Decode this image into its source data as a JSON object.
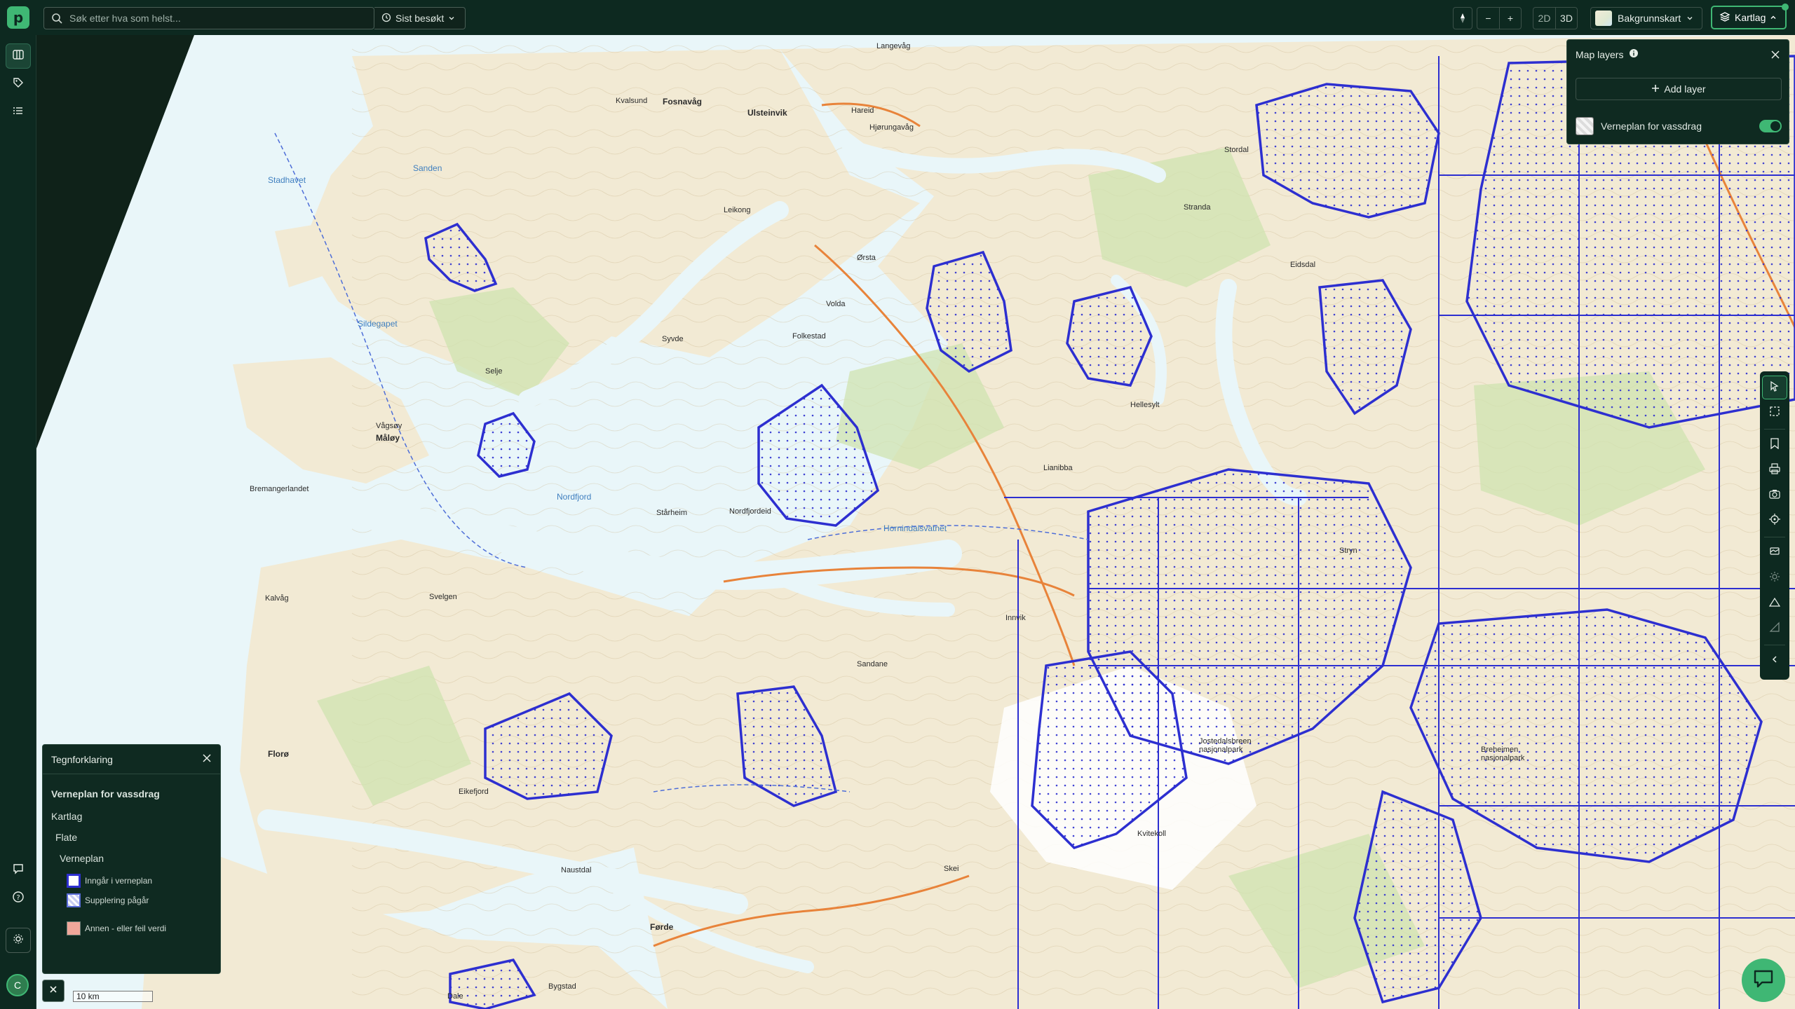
{
  "app": {
    "logo_letter": "p"
  },
  "search": {
    "placeholder": "Søk etter hva som helst...",
    "recent_label": "Sist besøkt"
  },
  "toolbar": {
    "zoom_out": "−",
    "zoom_in": "+",
    "mode_2d": "2D",
    "mode_3d": "3D",
    "basemap_label": "Bakgrunnskart",
    "layers_label": "Kartlag"
  },
  "layers_panel": {
    "title": "Map layers",
    "add_label": "Add layer",
    "items": [
      {
        "label": "Verneplan for vassdrag",
        "enabled": true
      }
    ]
  },
  "legend": {
    "title": "Tegnforklaring",
    "layer_name": "Verneplan for vassdrag",
    "group": "Kartlag",
    "subgroup": "Flate",
    "category": "Verneplan",
    "items": [
      {
        "label": "Inngår i verneplan",
        "color": "#2d2fd0"
      },
      {
        "label": "Supplering pågår",
        "color": "#5a6dd8"
      },
      {
        "label": "Annen - eller feil verdi",
        "color": "#f0a79a"
      }
    ]
  },
  "scale_label": "10 km",
  "user_initial": "C",
  "map_labels": [
    {
      "text": "Fosnavåg",
      "kind": "big"
    },
    {
      "text": "Ulsteinvik",
      "kind": "big"
    },
    {
      "text": "Måløy",
      "kind": "big"
    },
    {
      "text": "Florø",
      "kind": "big"
    },
    {
      "text": "Førde",
      "kind": "big"
    },
    {
      "text": "Stadhavet",
      "kind": "water"
    },
    {
      "text": "Sanden",
      "kind": "water"
    },
    {
      "text": "Sildegapet",
      "kind": "water"
    },
    {
      "text": "Nordfjord",
      "kind": "water"
    },
    {
      "text": "Hornindalsvatnet",
      "kind": "water"
    },
    {
      "text": "Langevåg",
      "kind": ""
    },
    {
      "text": "Hareid",
      "kind": ""
    },
    {
      "text": "Volda",
      "kind": ""
    },
    {
      "text": "Stryn",
      "kind": ""
    },
    {
      "text": "Stordal",
      "kind": ""
    },
    {
      "text": "Stranda",
      "kind": ""
    },
    {
      "text": "Eidsdal",
      "kind": ""
    },
    {
      "text": "Hellesylt",
      "kind": ""
    },
    {
      "text": "Stårheim",
      "kind": ""
    },
    {
      "text": "Nordfjordeid",
      "kind": ""
    },
    {
      "text": "Sandane",
      "kind": ""
    },
    {
      "text": "Innvik",
      "kind": ""
    },
    {
      "text": "Kalvåg",
      "kind": ""
    },
    {
      "text": "Svelgen",
      "kind": ""
    },
    {
      "text": "Eikefjord",
      "kind": ""
    },
    {
      "text": "Naustdal",
      "kind": ""
    },
    {
      "text": "Bygstad",
      "kind": ""
    },
    {
      "text": "Skei",
      "kind": ""
    },
    {
      "text": "Jostedalsbreen nasjonalpark",
      "kind": ""
    },
    {
      "text": "Breheimen nasjonalpark",
      "kind": ""
    },
    {
      "text": "Kvitekoll",
      "kind": ""
    },
    {
      "text": "Lianibba",
      "kind": ""
    },
    {
      "text": "Vågsøy",
      "kind": ""
    },
    {
      "text": "Bremangerlandet",
      "kind": ""
    },
    {
      "text": "Selje",
      "kind": ""
    },
    {
      "text": "Leikong",
      "kind": ""
    },
    {
      "text": "Folkestad",
      "kind": ""
    },
    {
      "text": "Syvde",
      "kind": ""
    },
    {
      "text": "Hjørungavåg",
      "kind": ""
    },
    {
      "text": "Ørsta",
      "kind": ""
    },
    {
      "text": "Kvalsund",
      "kind": ""
    },
    {
      "text": "Dale",
      "kind": ""
    }
  ]
}
